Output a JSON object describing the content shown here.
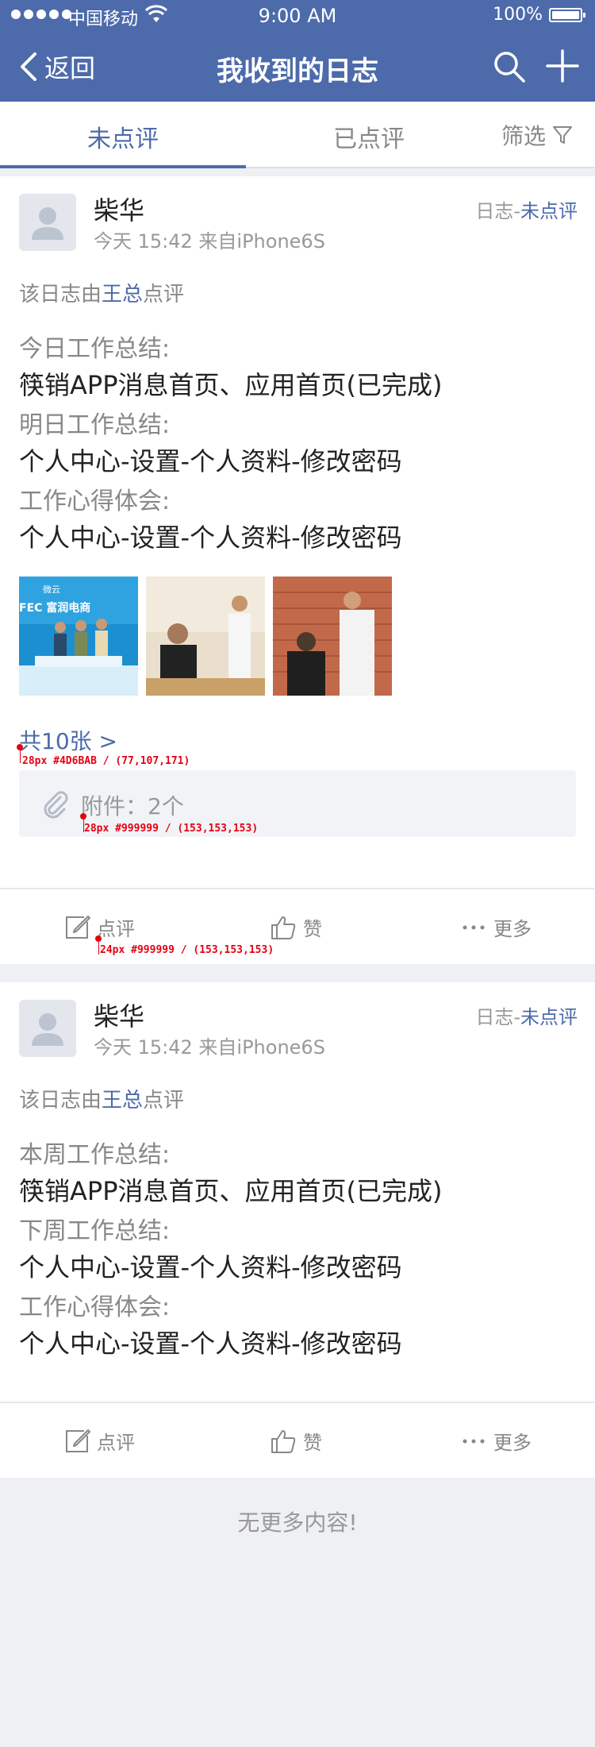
{
  "status_bar": {
    "carrier": "中国移动",
    "time": "9:00 AM",
    "battery": "100%"
  },
  "nav": {
    "back_label": "返回",
    "title": "我收到的日志"
  },
  "tabs": {
    "unreviewed": "未点评",
    "reviewed": "已点评",
    "filter": "筛选"
  },
  "theme": {
    "accent": "#4d6bab",
    "secondary_text": "#999999",
    "annotation": "#e60012"
  },
  "posts": [
    {
      "author": "柴华",
      "meta": "今天 15:42 来自iPhone6S",
      "type_prefix": "日志-",
      "type_status": "未点评",
      "reviewed_prefix": "该日志由",
      "reviewer": "王总",
      "reviewed_suffix": "点评",
      "sections": [
        {
          "label": "今日工作总结:",
          "text": "筷销APP消息首页、应用首页(已完成)"
        },
        {
          "label": "明日工作总结:",
          "text": "个人中心-设置-个人资料-修改密码"
        },
        {
          "label": "工作心得体会:",
          "text": "个人中心-设置-个人资料-修改密码"
        }
      ],
      "photo_count_label": "共10张 >",
      "attachment_label": "附件：2个",
      "actions": {
        "review": "点评",
        "like": "赞",
        "more": "更多"
      }
    },
    {
      "author": "柴华",
      "meta": "今天 15:42 来自iPhone6S",
      "type_prefix": "日志-",
      "type_status": "未点评",
      "reviewed_prefix": "该日志由",
      "reviewer": "王总",
      "reviewed_suffix": "点评",
      "sections": [
        {
          "label": "本周工作总结:",
          "text": "筷销APP消息首页、应用首页(已完成)"
        },
        {
          "label": "下周工作总结:",
          "text": "个人中心-设置-个人资料-修改密码"
        },
        {
          "label": "工作心得体会:",
          "text": "个人中心-设置-个人资料-修改密码"
        }
      ],
      "actions": {
        "review": "点评",
        "like": "赞",
        "more": "更多"
      }
    }
  ],
  "photo_texts": {
    "brand": "微云",
    "fec": "FEC 富润电商"
  },
  "annotations": {
    "photo_count": "28px #4D6BAB / (77,107,171)",
    "attachment": "28px #999999 / (153,153,153)",
    "action": "24px #999999 / (153,153,153)"
  },
  "footer": {
    "end_text": "无更多内容!"
  }
}
